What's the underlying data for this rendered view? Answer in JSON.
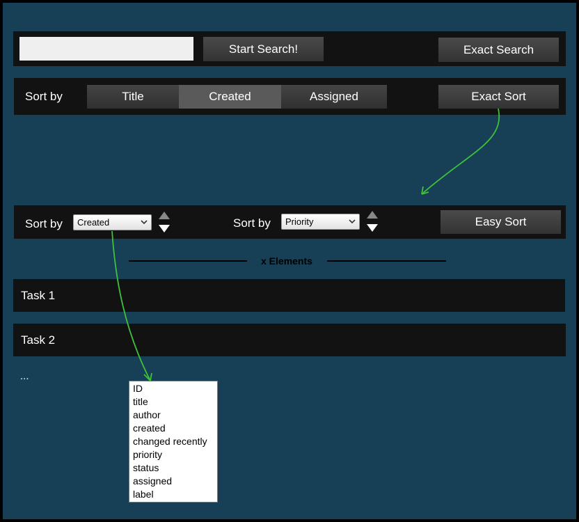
{
  "search_bar": {
    "input_value": "",
    "start_search_label": "Start Search!",
    "exact_search_label": "Exact Search"
  },
  "sort_bar_top": {
    "label": "Sort by",
    "tabs": [
      {
        "label": "Title",
        "active": false
      },
      {
        "label": "Created",
        "active": true
      },
      {
        "label": "Assigned",
        "active": false
      }
    ],
    "exact_sort_label": "Exact Sort"
  },
  "sort_bar_bottom": {
    "label1": "Sort by",
    "select1_value": "Created",
    "label2": "Sort by",
    "select2_value": "Priority",
    "easy_sort_label": "Easy Sort"
  },
  "elements_divider": {
    "label": "x Elements"
  },
  "tasks": [
    "Task 1",
    "Task 2"
  ],
  "more_indicator": "...",
  "dropdown_options": [
    "ID",
    "title",
    "author",
    "created",
    "changed recently",
    "priority",
    "status",
    "assigned",
    "label"
  ],
  "colors": {
    "background": "#173f55",
    "bar": "#121212",
    "arrow": "#3fc23a"
  },
  "icons": [
    "chevron-down-icon",
    "sort-up-icon",
    "sort-down-icon",
    "green-arrow"
  ]
}
